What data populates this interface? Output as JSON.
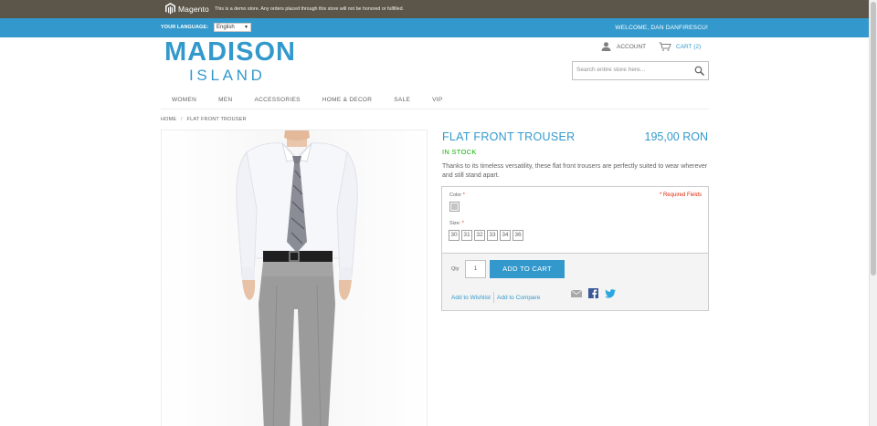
{
  "demo_bar": {
    "brand": "Magento",
    "notice": "This is a demo store. Any orders placed through this store will not be honored or fulfilled."
  },
  "header_bar": {
    "language_label": "YOUR LANGUAGE:",
    "language_value": "English",
    "welcome": "WELCOME, DAN DANFIRESCU!"
  },
  "logo": {
    "line1": "MADISON",
    "line2": "ISLAND"
  },
  "account": {
    "account_label": "ACCOUNT",
    "cart_label": "CART (2)"
  },
  "search": {
    "placeholder": "Search entire store here..."
  },
  "nav": {
    "items": [
      "WOMEN",
      "MEN",
      "ACCESSORIES",
      "HOME & DECOR",
      "SALE",
      "VIP"
    ]
  },
  "breadcrumb": {
    "home": "HOME",
    "separator": "/",
    "current": "FLAT FRONT TROUSER"
  },
  "product": {
    "name": "FLAT FRONT TROUSER",
    "price": "195,00 RON",
    "availability": "IN STOCK",
    "description": "Thanks to its timeless versatility, these flat front trousers are perfectly suited to wear wherever and still stand apart."
  },
  "options": {
    "color_label": "Color",
    "required_marker": "*",
    "required_fields": "* Required Fields",
    "size_label": "Size:",
    "sizes": [
      "30",
      "31",
      "32",
      "33",
      "34",
      "36"
    ]
  },
  "cart_form": {
    "qty_label": "Qty",
    "qty_value": "1",
    "add_to_cart": "ADD TO CART",
    "add_to_wishlist": "Add to Wishlist",
    "add_to_compare": "Add to Compare"
  },
  "colors": {
    "accent": "#3399cc",
    "demo_bar": "#5b5649",
    "in_stock": "#11b400",
    "required": "#df280a"
  }
}
